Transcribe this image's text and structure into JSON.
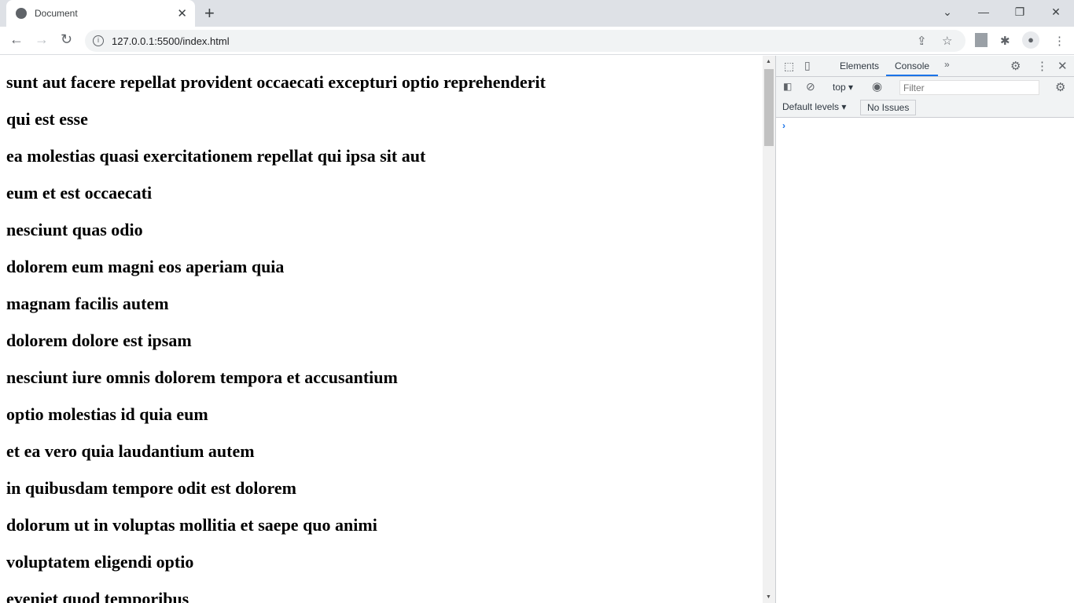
{
  "browser": {
    "tab_title": "Document",
    "url": "127.0.0.1:5500/index.html"
  },
  "page": {
    "headings": [
      "sunt aut facere repellat provident occaecati excepturi optio reprehenderit",
      "qui est esse",
      "ea molestias quasi exercitationem repellat qui ipsa sit aut",
      "eum et est occaecati",
      "nesciunt quas odio",
      "dolorem eum magni eos aperiam quia",
      "magnam facilis autem",
      "dolorem dolore est ipsam",
      "nesciunt iure omnis dolorem tempora et accusantium",
      "optio molestias id quia eum",
      "et ea vero quia laudantium autem",
      "in quibusdam tempore odit est dolorem",
      "dolorum ut in voluptas mollitia et saepe quo animi",
      "voluptatem eligendi optio",
      "eveniet quod temporibus"
    ]
  },
  "devtools": {
    "tabs": [
      "Elements",
      "Console"
    ],
    "active_tab": "Console",
    "context": "top",
    "filter_placeholder": "Filter",
    "levels": "Default levels",
    "issues": "No Issues",
    "accent": "#1a73e8"
  }
}
